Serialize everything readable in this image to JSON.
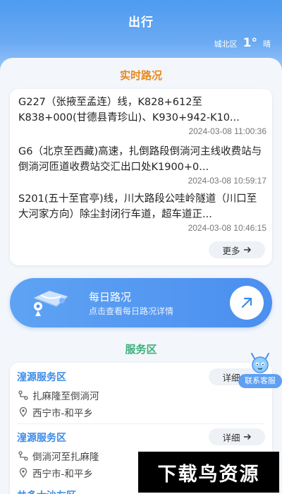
{
  "header": {
    "title": "出行"
  },
  "weather": {
    "district": "城北区",
    "temperature": "1°",
    "condition": "晴"
  },
  "road_section": {
    "title": "实时路况"
  },
  "news": [
    {
      "text": "G227（张掖至孟连）线，K828+612至K838+000(甘德县青珍山)、K930+942-K10...",
      "time": "2024-03-08 11:00:36"
    },
    {
      "text": "G6（北京至西藏)高速，扎倒路段倒淌河主线收费站与倒淌河匝道收费站交汇出口处K1900+0...",
      "time": "2024-03-08 10:59:17"
    },
    {
      "text": "S201(五十至官亭)线，川大路段公哇岭隧道（川口至大河家方向）除尘封闭行车道，超车道正...",
      "time": "2024-03-08 10:46:15"
    }
  ],
  "more_label": "更多",
  "daily": {
    "title": "每日路况",
    "subtitle": "点击查看每日路况详情"
  },
  "service_section": {
    "title": "服务区"
  },
  "services": [
    {
      "name": "湟源服务区",
      "route": "扎麻隆至倒淌河",
      "location": "西宁市-和平乡",
      "detail_label": "详细"
    },
    {
      "name": "湟源服务区",
      "route": "倒淌河至扎麻隆",
      "location": "西宁市-和平乡",
      "detail_label": "详细"
    }
  ],
  "next_service_partial": "共多大沙左区",
  "support": {
    "label": "联系客服"
  },
  "watermark": "下载鸟资源",
  "colors": {
    "accent_blue": "#4b8ff0",
    "road_title": "#e8891f",
    "service_title": "#3bb07a"
  }
}
